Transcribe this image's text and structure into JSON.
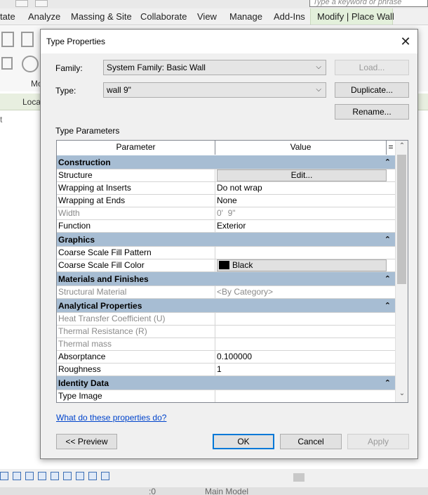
{
  "app": {
    "search_placeholder": "Type a keyword or phrase",
    "tabs": [
      {
        "label": "tate"
      },
      {
        "label": "Analyze"
      },
      {
        "label": "Massing & Site"
      },
      {
        "label": "Collaborate"
      },
      {
        "label": "View"
      },
      {
        "label": "Manage"
      },
      {
        "label": "Add-Ins"
      },
      {
        "label": "Modify | Place Wall"
      }
    ],
    "ribbon_label": "Mo",
    "optbar_label": "Loca",
    "side_label": "t",
    "status_model": "Main Model",
    "status_zero": ":0"
  },
  "dialog": {
    "title": "Type Properties",
    "close_symbol": "✕",
    "family_label": "Family:",
    "family_value": "System Family: Basic Wall",
    "type_label": "Type:",
    "type_value": "wall 9\"",
    "load_button": "Load...",
    "duplicate_button": "Duplicate...",
    "rename_button": "Rename...",
    "type_parameters_label": "Type Parameters",
    "grid": {
      "col_parameter": "Parameter",
      "col_value": "Value",
      "col_sort": "=",
      "groups": [
        {
          "name": "Construction",
          "rows": [
            {
              "param": "Structure",
              "value": "Edit...",
              "kind": "button"
            },
            {
              "param": "Wrapping at Inserts",
              "value": "Do not wrap"
            },
            {
              "param": "Wrapping at Ends",
              "value": "None"
            },
            {
              "param": "Width",
              "value": "0'  9\"",
              "disabled": true
            },
            {
              "param": "Function",
              "value": "Exterior"
            }
          ]
        },
        {
          "name": "Graphics",
          "rows": [
            {
              "param": "Coarse Scale Fill Pattern",
              "value": ""
            },
            {
              "param": "Coarse Scale Fill Color",
              "value": "Black",
              "kind": "color"
            }
          ]
        },
        {
          "name": "Materials and Finishes",
          "rows": [
            {
              "param": "Structural Material",
              "value": "<By Category>",
              "disabled": true
            }
          ]
        },
        {
          "name": "Analytical Properties",
          "rows": [
            {
              "param": "Heat Transfer Coefficient (U)",
              "value": "",
              "disabled": true
            },
            {
              "param": "Thermal Resistance (R)",
              "value": "",
              "disabled": true
            },
            {
              "param": "Thermal mass",
              "value": "",
              "disabled": true
            },
            {
              "param": "Absorptance",
              "value": "0.100000"
            },
            {
              "param": "Roughness",
              "value": "1"
            }
          ]
        },
        {
          "name": "Identity Data",
          "rows": [
            {
              "param": "Type Image",
              "value": ""
            }
          ]
        }
      ]
    },
    "help_link": "What do these properties do?",
    "preview_button": "<< Preview",
    "ok_button": "OK",
    "cancel_button": "Cancel",
    "apply_button": "Apply"
  },
  "colors": {
    "group_header": "#a7bdd3",
    "active_tab": "#e3f0db",
    "link": "#0044cc",
    "default_button_border": "#0078d7"
  }
}
